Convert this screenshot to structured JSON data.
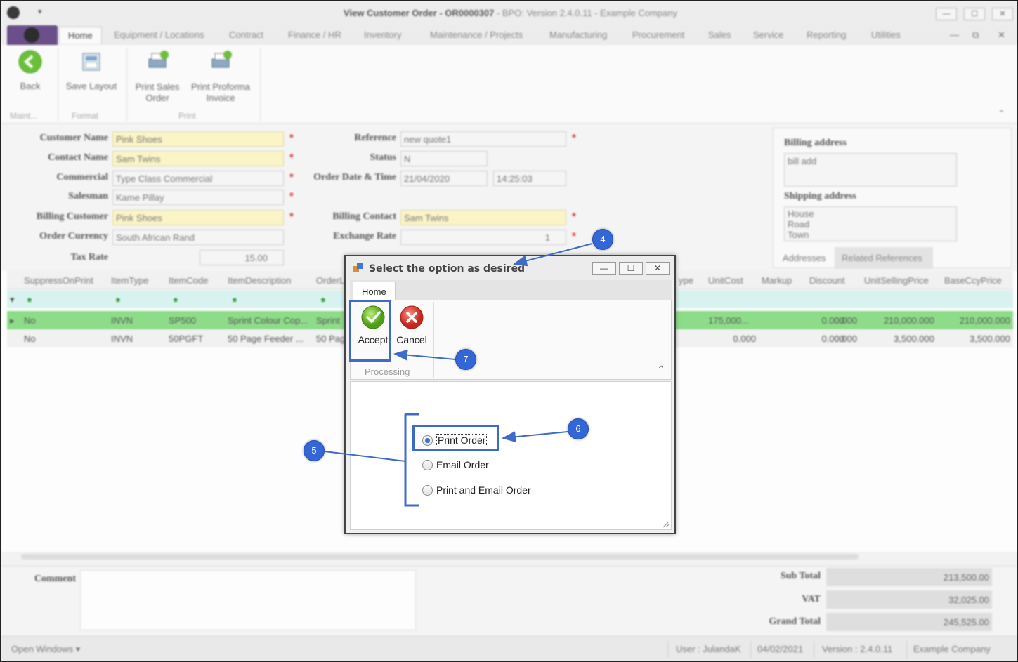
{
  "window": {
    "title_bold": "View Customer Order - OR0000307",
    "title_rest": " - BPO: Version 2.4.0.11 - Example Company",
    "qat_glyph": "▾",
    "buttons": [
      "—",
      "☐",
      "✕"
    ]
  },
  "ribbon_tabs": [
    "Home",
    "Equipment / Locations",
    "Contract",
    "Finance / HR",
    "Inventory",
    "Maintenance / Projects",
    "Manufacturing",
    "Procurement",
    "Sales",
    "Service",
    "Reporting",
    "Utilities"
  ],
  "ribbon_tab_controls": [
    "—",
    "⧉",
    "✕"
  ],
  "ribbon": {
    "back": "Back",
    "save_layout": "Save Layout",
    "print_sales_order": "Print Sales Order",
    "print_proforma": "Print Proforma Invoice",
    "groups": [
      "Maint...",
      "Format",
      "Print"
    ],
    "collapse_glyph": "⌃"
  },
  "form": {
    "customer_name_label": "Customer Name",
    "customer_name": "Pink Shoes",
    "contact_name_label": "Contact Name",
    "contact_name": "Sam Twins",
    "commercial_label": "Commercial",
    "commercial": "Type Class Commercial",
    "salesman_label": "Salesman",
    "salesman": "Kame Pillay",
    "billing_customer_label": "Billing Customer",
    "billing_customer": "Pink Shoes",
    "order_currency_label": "Order Currency",
    "order_currency": "South African Rand",
    "tax_rate_label": "Tax Rate",
    "tax_rate": "15.00",
    "reference_label": "Reference",
    "reference": "new quote1",
    "status_label": "Status",
    "status": "N",
    "order_date_label": "Order Date & Time",
    "order_date": "21/04/2020",
    "order_time": "14:25:03",
    "billing_contact_label": "Billing Contact",
    "billing_contact": "Sam Twins",
    "exchange_rate_label": "Exchange Rate",
    "exchange_rate": "1",
    "required_marker": "*"
  },
  "addresses": {
    "billing_label": "Billing address",
    "billing": "bill add",
    "shipping_label": "Shipping address",
    "shipping_lines": [
      "House",
      "Road",
      "Town"
    ],
    "tabs": [
      "Addresses",
      "Related References"
    ]
  },
  "grid": {
    "columns_left": [
      "SuppressOnPrint",
      "ItemType",
      "ItemCode",
      "ItemDescription",
      "OrderL"
    ],
    "columns_right": [
      "ype",
      "UnitCost",
      "Markup",
      "Discount",
      "UnitSellingPrice",
      "BaseCcyPrice"
    ],
    "filter_glyph": "●",
    "row_indicator": "▸",
    "filter_indicator": "▾",
    "rows": [
      {
        "suppress": "No",
        "type": "INVN",
        "code": "SP500",
        "desc": "Sprint Colour Cop...",
        "ordl": "Sprint",
        "cost": "175,000...",
        "markup": "0.000",
        "discount": "0.000",
        "selling": "210,000.000",
        "base": "210,000.000"
      },
      {
        "suppress": "No",
        "type": "INVN",
        "code": "50PGFT",
        "desc": "50 Page Feeder ...",
        "ordl": "50 Pag",
        "cost": "0.000",
        "markup": "0.000",
        "discount": "0.000",
        "selling": "3,500.000",
        "base": "3,500.000"
      }
    ]
  },
  "totals": {
    "comment_label": "Comment",
    "sub_total_label": "Sub Total",
    "sub_total": "213,500.00",
    "vat_label": "VAT",
    "vat": "32,025.00",
    "grand_total_label": "Grand Total",
    "grand_total": "245,525.00"
  },
  "statusbar": {
    "open_windows": "Open Windows ▾",
    "user": "User : JulandaK",
    "date": "04/02/2021",
    "version": "Version : 2.4.0.11",
    "company": "Example Company"
  },
  "dialog": {
    "title": "Select the option as desired",
    "buttons": [
      "—",
      "☐",
      "✕"
    ],
    "tab": "Home",
    "accept": "Accept",
    "cancel": "Cancel",
    "group": "Processing",
    "collapse_glyph": "⌃",
    "options": [
      {
        "label": "Print Order",
        "selected": true
      },
      {
        "label": "Email Order",
        "selected": false
      },
      {
        "label": "Print and Email Order",
        "selected": false
      }
    ]
  },
  "annotations": {
    "callouts": [
      "4",
      "5",
      "6",
      "7"
    ],
    "highlight_color": "#3e6bc7",
    "callout_color": "#3366d6"
  }
}
